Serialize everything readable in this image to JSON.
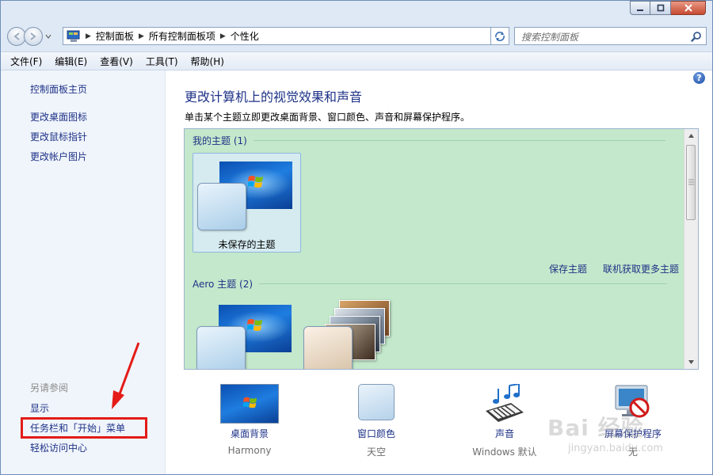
{
  "address": {
    "breadcrumbs": [
      "控制面板",
      "所有控制面板项",
      "个性化"
    ]
  },
  "search": {
    "placeholder": "搜索控制面板"
  },
  "menu": [
    "文件(F)",
    "编辑(E)",
    "查看(V)",
    "工具(T)",
    "帮助(H)"
  ],
  "sidebar": {
    "home": "控制面板主页",
    "links": [
      "更改桌面图标",
      "更改鼠标指针",
      "更改帐户图片"
    ],
    "see_also_label": "另请参阅",
    "see_also": [
      "显示",
      "任务栏和「开始」菜单",
      "轻松访问中心"
    ]
  },
  "main": {
    "title": "更改计算机上的视觉效果和声音",
    "description": "单击某个主题立即更改桌面背景、窗口颜色、声音和屏幕保护程序。",
    "help": "?",
    "my_themes_header": "我的主题 (1)",
    "unsaved_theme": "未保存的主题",
    "save_theme": "保存主题",
    "get_more_themes": "联机获取更多主题",
    "aero_header": "Aero 主题 (2)"
  },
  "settings": [
    {
      "label": "桌面背景",
      "value": "Harmony"
    },
    {
      "label": "窗口颜色",
      "value": "天空"
    },
    {
      "label": "声音",
      "value": "Windows 默认"
    },
    {
      "label": "屏幕保护程序",
      "value": "无"
    }
  ],
  "watermark": {
    "brand": "Bai 经验",
    "url": "jingyan.baidu.com"
  },
  "colors": {
    "link": "#1e3287",
    "highlight": "#e41b17",
    "gallery_bg": "#c3e8cb"
  }
}
